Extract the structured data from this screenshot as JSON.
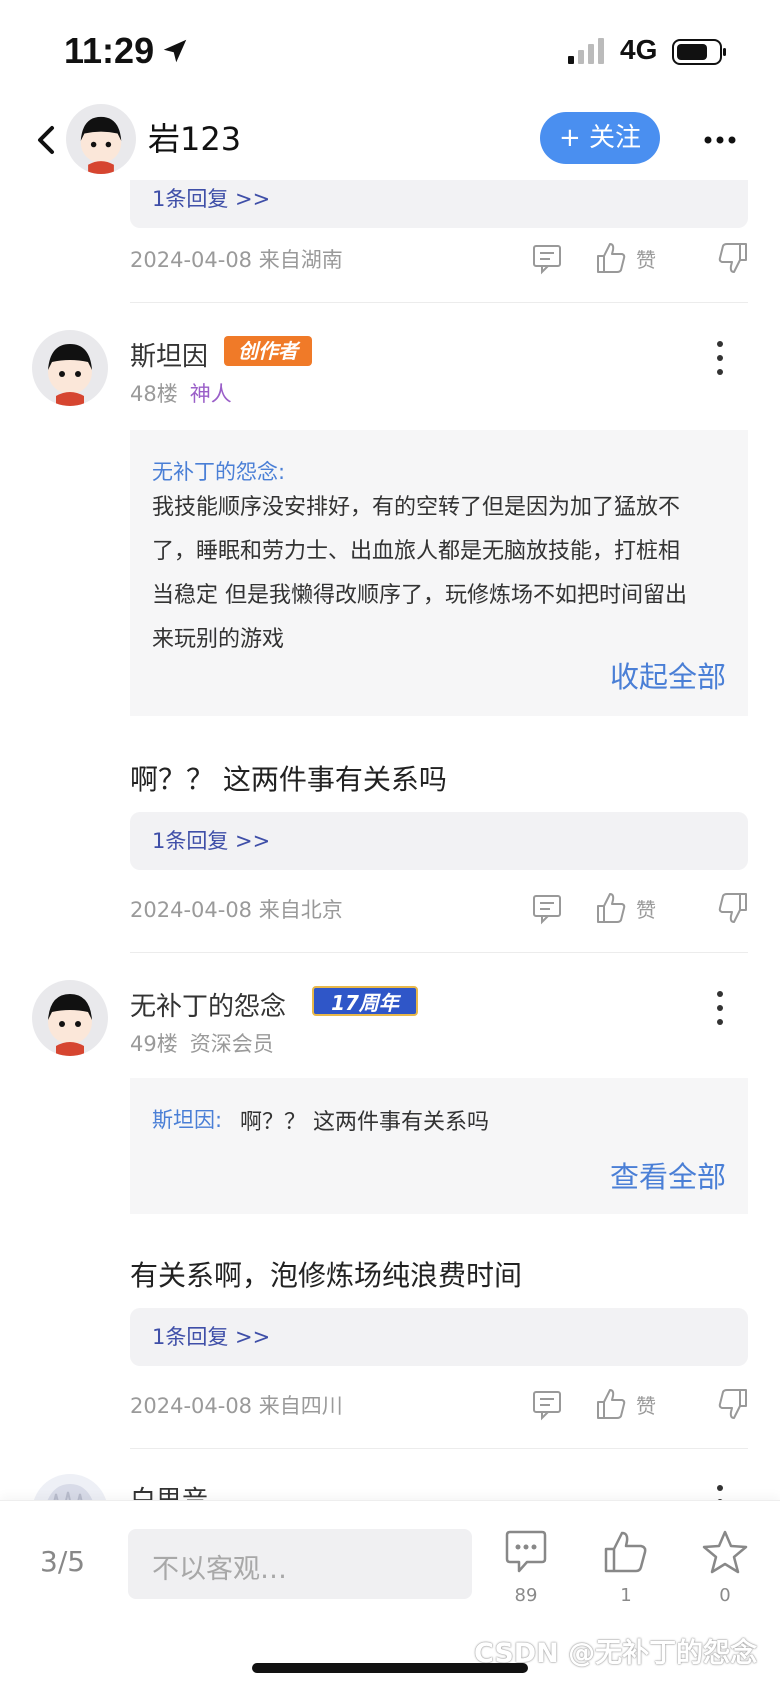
{
  "status_bar": {
    "time": "11:29",
    "network": "4G"
  },
  "header": {
    "title": "岩123",
    "follow_label": "+ 关注"
  },
  "top_reply": {
    "reply_link": "1条回复 >>",
    "meta": "2024-04-08 来自湖南",
    "like_label": "赞"
  },
  "posts": [
    {
      "user": "斯坦因",
      "badge": "创作者",
      "floor": "48楼",
      "level": "神人",
      "quote_author": "无补丁的怨念:",
      "quote_lines": [
        "我技能顺序没安排好，有的空转了但是因为加了猛放不",
        "了，睡眠和劳力士、出血旅人都是无脑放技能，打桩相",
        "当稳定 但是我懒得改顺序了，玩修炼场不如把时间留出",
        "来玩别的游戏"
      ],
      "quote_link": "收起全部",
      "text": "啊？？ 这两件事有关系吗",
      "reply_link": "1条回复 >>",
      "meta": "2024-04-08 来自北京",
      "like_label": "赞"
    },
    {
      "user": "无补丁的怨念",
      "badge": "17周年",
      "floor": "49楼",
      "level": "资深会员",
      "quote_author": "斯坦因:",
      "quote_text": "啊？？ 这两件事有关系吗",
      "quote_link": "查看全部",
      "text": "有关系啊，泡修炼场纯浪费时间",
      "reply_link": "1条回复 >>",
      "meta": "2024-04-08 来自四川",
      "like_label": "赞"
    },
    {
      "user": "白思音"
    }
  ],
  "bottom_bar": {
    "page": "3/5",
    "input_placeholder": "不以客观…",
    "comment_count": "89",
    "like_count": "1",
    "fav_count": "0",
    "watermark": "CSDN @无补丁的怨念"
  },
  "colors": {
    "accent": "#4a8ff0",
    "link": "#4a7fd6",
    "creator_badge": "#f07a28",
    "anniv_badge": "#2f56c8",
    "level_purple": "#9a5fc8"
  },
  "icons": [
    "location-arrow-icon",
    "signal-icon",
    "battery-icon",
    "back-chevron-icon",
    "more-dots-icon",
    "comment-icon",
    "thumbs-up-icon",
    "thumbs-down-icon",
    "kebab-icon",
    "star-icon"
  ]
}
